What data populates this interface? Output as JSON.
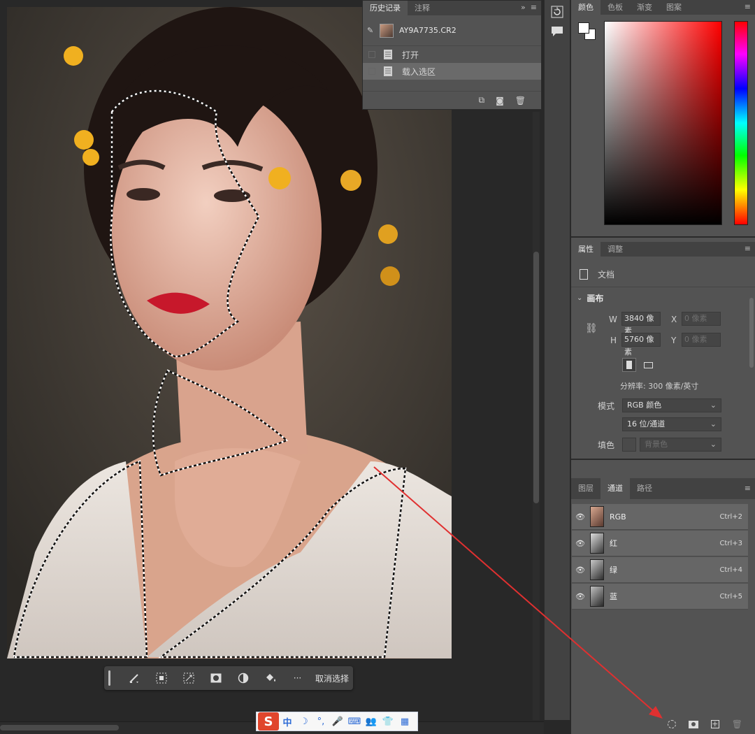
{
  "history": {
    "tabs": [
      "历史记录",
      "注释"
    ],
    "menu": "»",
    "snapshot_name": "AY9A7735.CR2",
    "items": [
      {
        "label": "打开"
      },
      {
        "label": "载入选区"
      }
    ]
  },
  "color": {
    "tabs": [
      "颜色",
      "色板",
      "渐变",
      "图案"
    ],
    "foreground": "#ffffff",
    "background": "#ffffff"
  },
  "properties": {
    "tabs": [
      "属性",
      "调整"
    ],
    "doc_label": "文档",
    "section": "画布",
    "w_label": "W",
    "w_value": "3840 像素",
    "h_label": "H",
    "h_value": "5760 像素",
    "x_label": "X",
    "x_placeholder": "0 像素",
    "y_label": "Y",
    "y_placeholder": "0 像素",
    "resolution": "分辨率: 300 像素/英寸",
    "mode_label": "模式",
    "mode_value": "RGB 颜色",
    "depth_value": "16 位/通道",
    "fill_label": "填色",
    "fill_value": "背景色"
  },
  "channels": {
    "tabs": [
      "图层",
      "通道",
      "路径"
    ],
    "rows": [
      {
        "name": "RGB",
        "shortcut": "Ctrl+2"
      },
      {
        "name": "红",
        "shortcut": "Ctrl+3"
      },
      {
        "name": "绿",
        "shortcut": "Ctrl+4"
      },
      {
        "name": "蓝",
        "shortcut": "Ctrl+5"
      }
    ]
  },
  "taskbar": {
    "more": "···",
    "deselect": "取消选择"
  },
  "ime": {
    "logo": "S",
    "lang": "中",
    "items": [
      "☽",
      "°,",
      "🎤",
      "⌨",
      "👥",
      "👕",
      "▦"
    ]
  },
  "colors": {
    "panel": "#535353",
    "panel_dark": "#424242",
    "annotation_arrow": "#e03030"
  }
}
